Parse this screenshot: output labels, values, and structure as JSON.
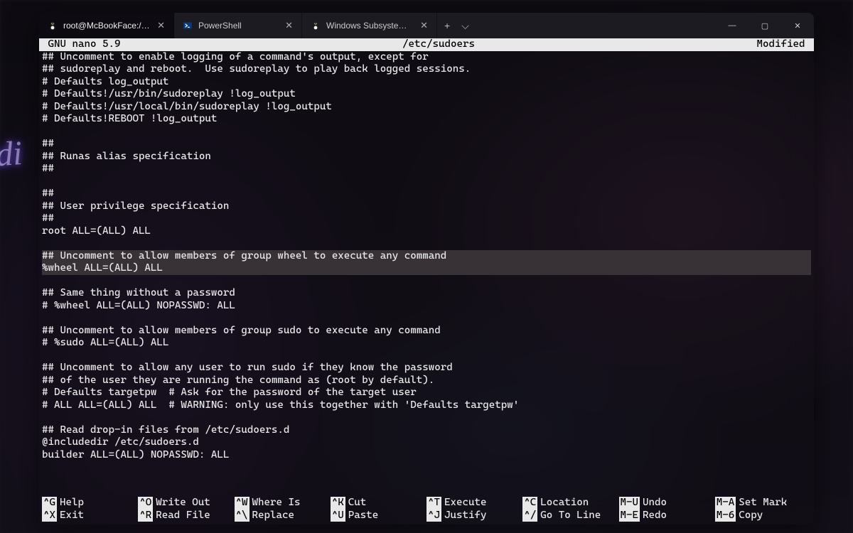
{
  "tabs": [
    {
      "label": "Windows Subsystem for Linux F",
      "icon": "tux"
    },
    {
      "label": "PowerShell",
      "icon": "ps"
    },
    {
      "label": "root@McBookFace:/mnt/c/User",
      "icon": "tux",
      "active": true
    }
  ],
  "window_controls": {
    "min": "—",
    "max": "▢",
    "close": "✕"
  },
  "tab_controls": {
    "new": "+",
    "dropdown": "⌵"
  },
  "nano": {
    "title_left": " GNU nano 5.9",
    "title_mid": "/etc/sudoers",
    "title_right": "Modified "
  },
  "lines": [
    "## Uncomment to enable logging of a command's output, except for",
    "## sudoreplay and reboot.  Use sudoreplay to play back logged sessions.",
    "# Defaults log_output",
    "# Defaults!/usr/bin/sudoreplay !log_output",
    "# Defaults!/usr/local/bin/sudoreplay !log_output",
    "# Defaults!REBOOT !log_output",
    "",
    "##",
    "## Runas alias specification",
    "##",
    "",
    "##",
    "## User privilege specification",
    "##",
    "root ALL=(ALL) ALL",
    "",
    "## Uncomment to allow members of group wheel to execute any command",
    "%wheel ALL=(ALL) ALL",
    "",
    "## Same thing without a password",
    "# %wheel ALL=(ALL) NOPASSWD: ALL",
    "",
    "## Uncomment to allow members of group sudo to execute any command",
    "# %sudo ALL=(ALL) ALL",
    "",
    "## Uncomment to allow any user to run sudo if they know the password",
    "## of the user they are running the command as (root by default).",
    "# Defaults targetpw  # Ask for the password of the target user",
    "# ALL ALL=(ALL) ALL  # WARNING: only use this together with 'Defaults targetpw'",
    "",
    "## Read drop-in files from /etc/sudoers.d",
    "@includedir /etc/sudoers.d",
    "builder ALL=(ALL) NOPASSWD: ALL"
  ],
  "highlight_lines": [
    16,
    17
  ],
  "shortcuts": [
    {
      "key": "^G",
      "label": "Help"
    },
    {
      "key": "^O",
      "label": "Write Out"
    },
    {
      "key": "^W",
      "label": "Where Is"
    },
    {
      "key": "^K",
      "label": "Cut"
    },
    {
      "key": "^T",
      "label": "Execute"
    },
    {
      "key": "^C",
      "label": "Location"
    },
    {
      "key": "M-U",
      "label": "Undo"
    },
    {
      "key": "M-A",
      "label": "Set Mark"
    },
    {
      "key": "^X",
      "label": "Exit"
    },
    {
      "key": "^R",
      "label": "Read File"
    },
    {
      "key": "^\\",
      "label": "Replace"
    },
    {
      "key": "^U",
      "label": "Paste"
    },
    {
      "key": "^J",
      "label": "Justify"
    },
    {
      "key": "^/",
      "label": "Go To Line"
    },
    {
      "key": "M-E",
      "label": "Redo"
    },
    {
      "key": "M-6",
      "label": "Copy"
    }
  ],
  "shortcut_order": [
    0,
    1,
    2,
    3,
    4,
    5,
    6,
    8,
    9,
    10,
    11,
    12,
    13,
    14
  ],
  "neon_text": "adi"
}
